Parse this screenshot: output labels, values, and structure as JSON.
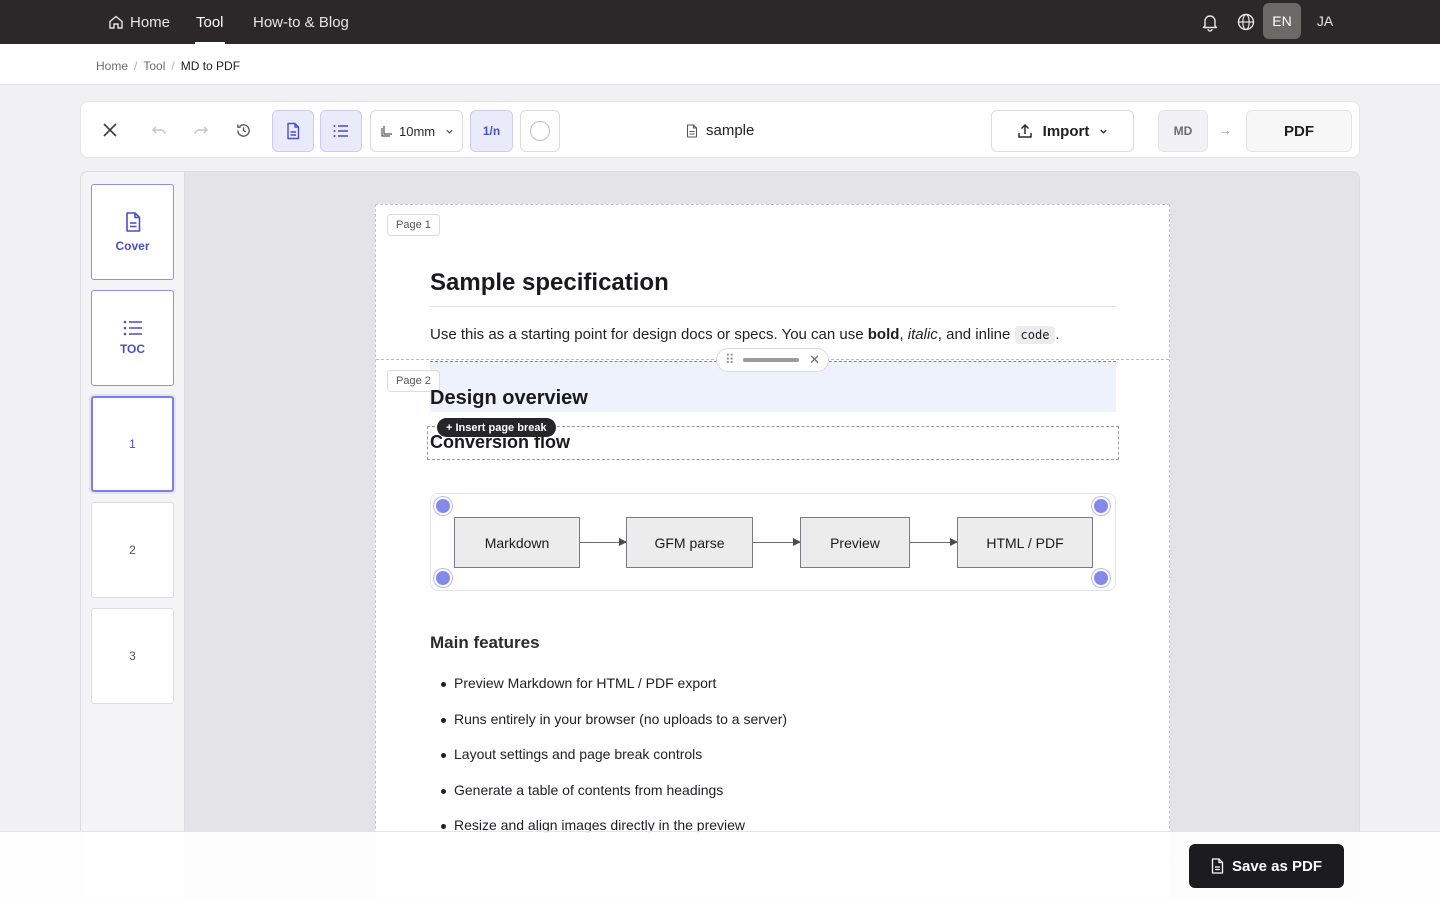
{
  "nav": {
    "items": [
      {
        "label": "Home",
        "icon": "home-icon"
      },
      {
        "label": "Tool"
      },
      {
        "label": "How-to & Blog"
      }
    ],
    "active": "Tool",
    "lang_en": "EN",
    "lang_ja": "JA",
    "lang_active": "EN"
  },
  "breadcrumb": {
    "items": [
      "Home",
      "Tool",
      "MD to PDF"
    ]
  },
  "toolbar": {
    "margin_value": "10mm",
    "page_number_label": "1/n",
    "filename": "sample",
    "import_label": "Import",
    "source_format": "MD",
    "target_format": "PDF"
  },
  "sidebar": {
    "thumbs": [
      {
        "label": "Cover",
        "icon": "document-icon"
      },
      {
        "label": "TOC",
        "icon": "list-icon"
      },
      {
        "label": "1"
      },
      {
        "label": "2"
      },
      {
        "label": "3"
      }
    ],
    "active": "1"
  },
  "document": {
    "page1_label": "Page 1",
    "page2_label": "Page 2",
    "title": "Sample specification",
    "intro": {
      "prefix": "Use this as a starting point for design docs or specs. You can use ",
      "bold": "bold",
      "comma1": ", ",
      "italic": "italic",
      "mid": ", and inline ",
      "code": "code",
      "suffix": "."
    },
    "section_design": "Design overview",
    "section_conversion": "Conversion flow",
    "insert_page_break": "+ Insert page break",
    "flow": [
      "Markdown",
      "GFM parse",
      "Preview",
      "HTML / PDF"
    ],
    "features_heading": "Main features",
    "features": [
      "Preview Markdown for HTML / PDF export",
      "Runs entirely in your browser (no uploads to a server)",
      "Layout settings and page break controls",
      "Generate a table of contents from headings",
      "Resize and align images directly in the preview"
    ]
  },
  "footer": {
    "save_label": "Save as PDF"
  },
  "colors": {
    "accent": "#4b4fc4",
    "nav_bg": "#2a2828",
    "handle": "#8589ea"
  }
}
